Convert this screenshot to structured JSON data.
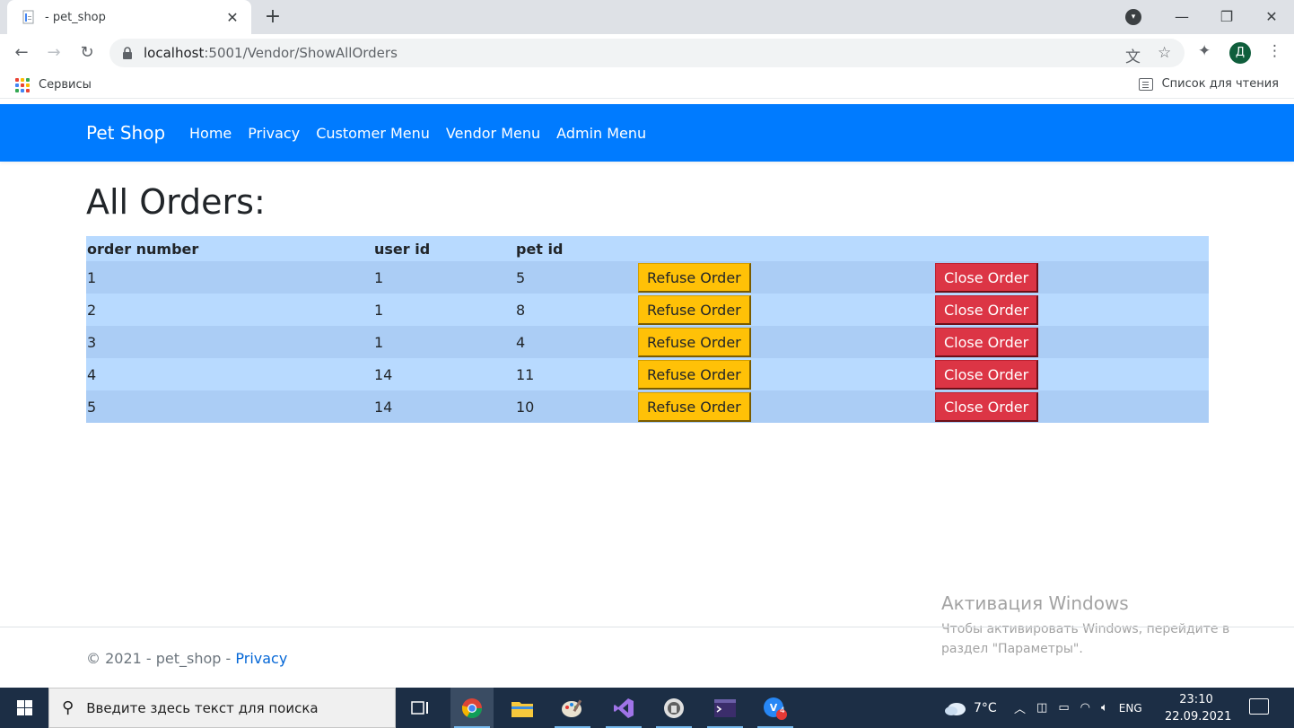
{
  "browser": {
    "tab_title": "- pet_shop",
    "tab_close": "✕",
    "new_tab": "+",
    "url_host": "localhost",
    "url_rest": ":5001/Vendor/ShowAllOrders",
    "profile_initial": "Д",
    "bookmark_apps_label": "Сервисы",
    "reading_list_label": "Список для чтения",
    "window_controls": {
      "minimize": "—",
      "restore": "❐",
      "close": "✕"
    }
  },
  "navbar": {
    "brand": "Pet Shop",
    "links": [
      "Home",
      "Privacy",
      "Customer Menu",
      "Vendor Menu",
      "Admin Menu"
    ],
    "bg_color": "#007bff"
  },
  "page": {
    "title": "All Orders:",
    "table": {
      "headers": [
        "order number",
        "user id",
        "pet id"
      ],
      "rows": [
        {
          "order_number": "1",
          "user_id": "1",
          "pet_id": "5"
        },
        {
          "order_number": "2",
          "user_id": "1",
          "pet_id": "8"
        },
        {
          "order_number": "3",
          "user_id": "1",
          "pet_id": "4"
        },
        {
          "order_number": "4",
          "user_id": "14",
          "pet_id": "11"
        },
        {
          "order_number": "5",
          "user_id": "14",
          "pet_id": "10"
        }
      ],
      "refuse_label": "Refuse Order",
      "close_label": "Close Order"
    }
  },
  "watermark": {
    "title": "Активация Windows",
    "line1": "Чтобы активировать Windows, перейдите в",
    "line2": "раздел \"Параметры\"."
  },
  "footer": {
    "text": "© 2021 - pet_shop - ",
    "link": "Privacy"
  },
  "taskbar": {
    "search_placeholder": "Введите здесь текст для поиска",
    "weather": "7°C",
    "language": "ENG",
    "time": "23:10",
    "date": "22.09.2021",
    "badge_count": "4"
  }
}
